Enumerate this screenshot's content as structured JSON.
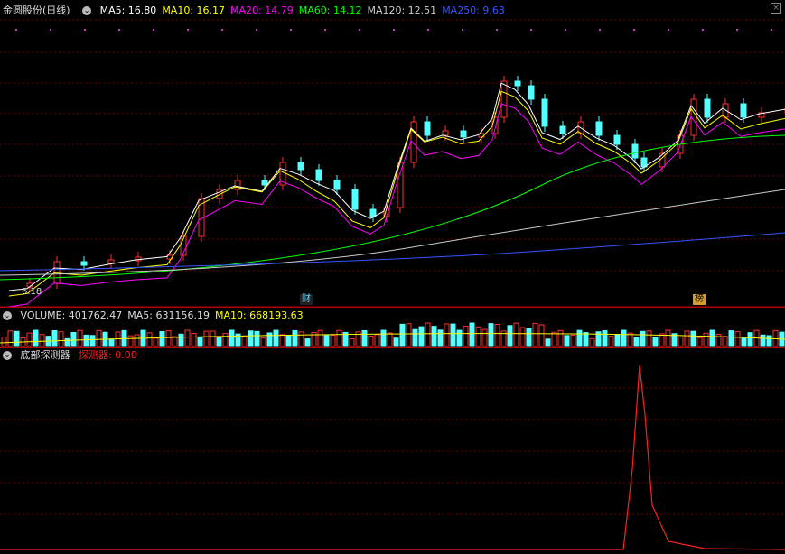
{
  "main_header": {
    "stock": "金圆股份(日线)",
    "ma_items": [
      {
        "label": "MA5: 16.80",
        "color": "#ffffff"
      },
      {
        "label": "MA10: 16.17",
        "color": "#ffff00"
      },
      {
        "label": "MA20: 14.79",
        "color": "#ff00ff"
      },
      {
        "label": "MA60: 14.12",
        "color": "#00ff00"
      },
      {
        "label": "MA120: 12.51",
        "color": "#cccccc"
      },
      {
        "label": "MA250: 9.63",
        "color": "#3355ff"
      }
    ]
  },
  "volume_header": {
    "items": [
      {
        "label": "VOLUME: 401762.47",
        "color": "#dddddd"
      },
      {
        "label": "MA5: 631156.19",
        "color": "#dddddd"
      },
      {
        "label": "MA10: 668193.63",
        "color": "#ffff00"
      }
    ]
  },
  "indicator_header": {
    "name": "底部探测器",
    "value_label": "探测器: 0.00",
    "value_color": "#ff2020"
  },
  "annotations": {
    "low_price": "6.18",
    "tag_cai": "财",
    "tag_bang": "榜"
  },
  "icons": {
    "header_circle": "chevron-down-icon",
    "close": "close-icon"
  }
}
